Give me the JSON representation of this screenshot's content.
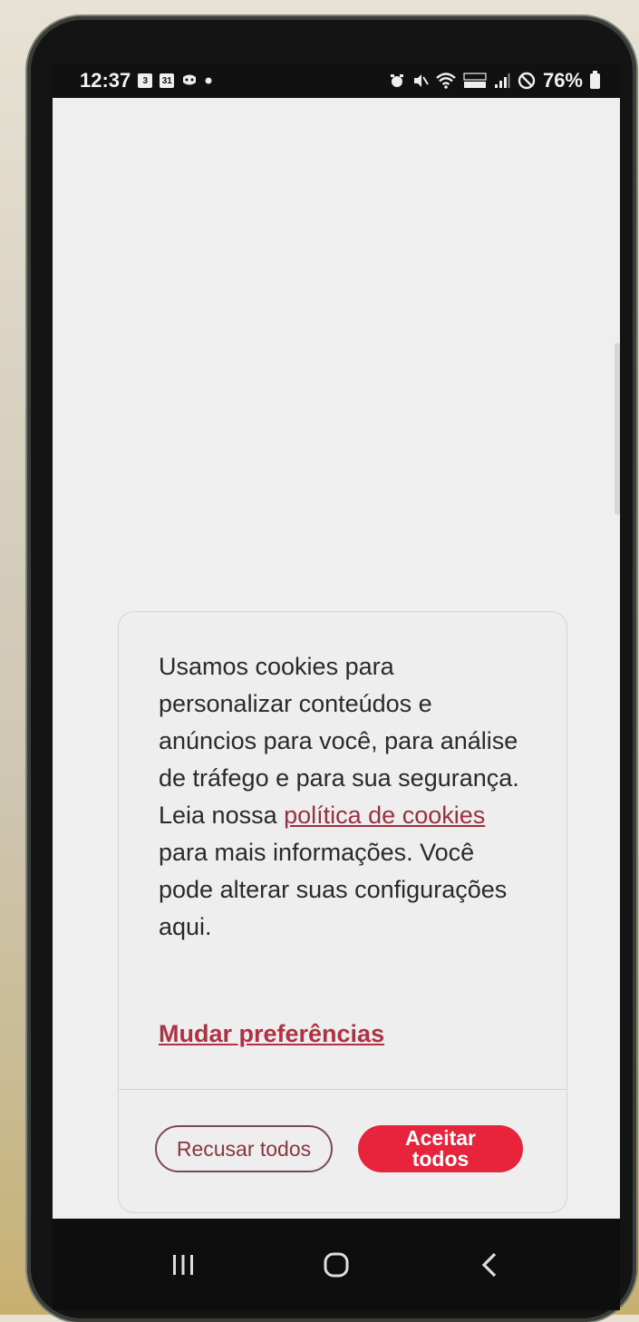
{
  "status_bar": {
    "time": "12:37",
    "battery": "76%",
    "left_icons": [
      "calendar-icon",
      "calendar-31-icon",
      "messenger-icon",
      "dot-icon"
    ],
    "right_icons": [
      "alarm-icon",
      "mute-icon",
      "wifi-icon",
      "volte-icon",
      "signal-icon",
      "dnd-icon",
      "battery-icon"
    ]
  },
  "cookie_banner": {
    "text_before": "Usamos cookies para personalizar conteúdos e anúncios para você, para análise de tráfego e para sua segurança. Leia nossa ",
    "policy_link": "política de cookies",
    "text_after": " para mais informações. Você pode alterar suas configurações aqui.",
    "preferences_link": "Mudar preferências",
    "reject_label": "Recusar todos",
    "accept_label": "Aceitar todos"
  },
  "colors": {
    "accent": "#e8243c",
    "link": "#b03242"
  },
  "nav_bar": {
    "icons": [
      "recent-apps-icon",
      "home-icon",
      "back-icon"
    ]
  }
}
